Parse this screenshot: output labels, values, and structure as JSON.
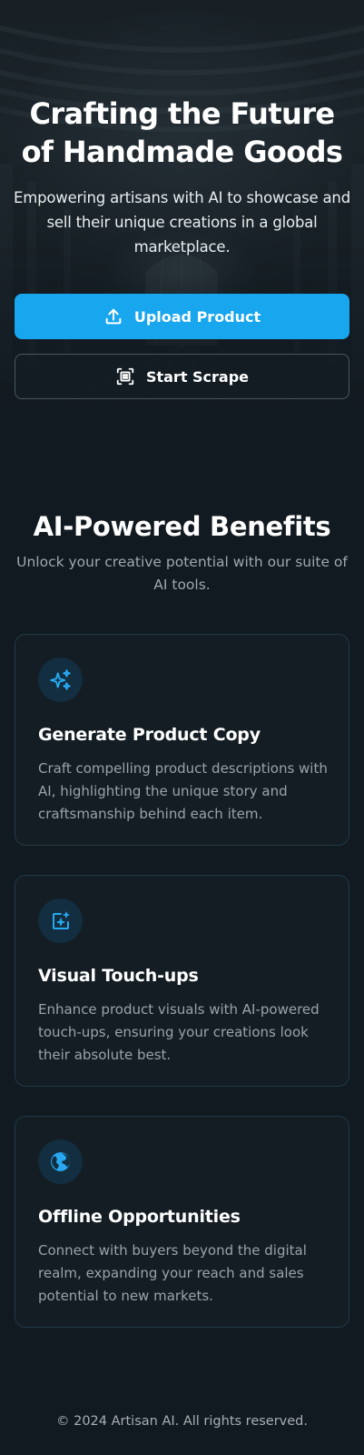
{
  "hero": {
    "title": "Crafting the Future of Handmade Goods",
    "subtitle": "Empowering artisans with AI to showcase and sell their unique creations in a global marketplace.",
    "upload_button": {
      "label": "Upload Product",
      "icon": "upload-icon"
    },
    "scrape_button": {
      "label": "Start Scrape",
      "icon": "scan-icon"
    }
  },
  "benefits": {
    "title": "AI-Powered Benefits",
    "subtitle": "Unlock your creative potential with our suite of AI tools.",
    "cards": [
      {
        "icon": "sparkles-icon",
        "title": "Generate Product Copy",
        "text": "Craft compelling product descriptions with AI, highlighting the unique story and craftsmanship behind each item."
      },
      {
        "icon": "image-sparkle-icon",
        "title": "Visual Touch-ups",
        "text": "Enhance product visuals with AI-powered touch-ups, ensuring your creations look their absolute best."
      },
      {
        "icon": "globe-icon",
        "title": "Offline Opportunities",
        "text": "Connect with buyers beyond the digital realm, expanding your reach and sales potential to new markets."
      }
    ]
  },
  "footer": {
    "text": "© 2024 Artisan AI. All rights reserved."
  },
  "colors": {
    "background": "#111a20",
    "accent": "#18a6ee",
    "card_border": "#1f3a48",
    "icon_bg": "#132e40",
    "muted_text": "#9aa3a9"
  }
}
